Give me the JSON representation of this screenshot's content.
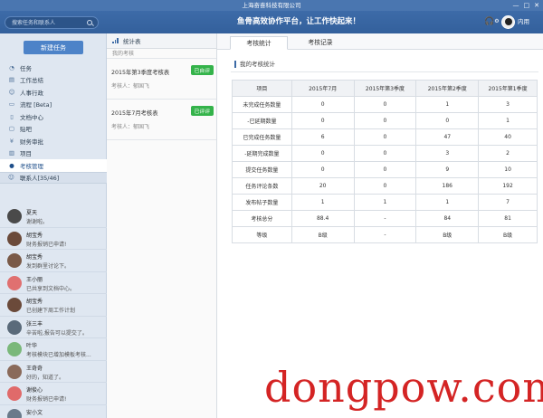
{
  "window": {
    "title": "上海奋奋科技有限公司",
    "controls": [
      "—",
      "□",
      "✕"
    ]
  },
  "header": {
    "search_placeholder": "搜索任务和联系人",
    "slogan": "鱼骨高效协作平台，让工作快起来！",
    "user_name": "内用"
  },
  "sidebar": {
    "new_task_label": "新建任务",
    "nav_items": [
      {
        "label": "任务",
        "icon": "task-icon",
        "glyph": "◔"
      },
      {
        "label": "工作总结",
        "icon": "summary-icon",
        "glyph": "▤"
      },
      {
        "label": "人事行政",
        "icon": "person-icon",
        "glyph": "☺"
      },
      {
        "label": "流程 [Beta]",
        "icon": "flow-icon",
        "glyph": "▭"
      },
      {
        "label": "文档中心",
        "icon": "document-icon",
        "glyph": "▯"
      },
      {
        "label": "贴吧",
        "icon": "forum-icon",
        "glyph": "▢"
      },
      {
        "label": "财务审批",
        "icon": "finance-icon",
        "glyph": "¥"
      },
      {
        "label": "项目",
        "icon": "project-icon",
        "glyph": "▥"
      },
      {
        "label": "考核管理",
        "icon": "assessment-icon",
        "glyph": "●",
        "active": true
      }
    ],
    "contacts_label": "联系人[35/46]",
    "contacts": [
      {
        "name": "夏天",
        "message": "谢谢啦。",
        "avatar_color": "#4a4a4a"
      },
      {
        "name": "胡宝秀",
        "message": "财务报销已申请!",
        "avatar_color": "#6b4a3a"
      },
      {
        "name": "胡宝秀",
        "message": "发到群里讨论下。",
        "avatar_color": "#7a5a48"
      },
      {
        "name": "王小丽",
        "message": "已共享到文档中心。",
        "avatar_color": "#e07070"
      },
      {
        "name": "胡宝秀",
        "message": "已创建下周工作计划",
        "avatar_color": "#6b4a3a"
      },
      {
        "name": "张三丰",
        "message": "辛苦啦,报告可以提交了。",
        "avatar_color": "#5a6a7a"
      },
      {
        "name": "叶华",
        "message": "考核模块已增加模板考核...",
        "avatar_color": "#7ab87a"
      },
      {
        "name": "王奇奇",
        "message": "好的，知道了。",
        "avatar_color": "#8a6a5a"
      },
      {
        "name": "谢俊心",
        "message": "财务报销已申请!",
        "avatar_color": "#e06a6a"
      },
      {
        "name": "安小文",
        "message": "",
        "avatar_color": "#6a7a8a"
      }
    ]
  },
  "middle": {
    "tab_label": "统计表",
    "subheader": "我的考核",
    "exams": [
      {
        "title": "2015年第3季度考核表",
        "meta": "考核人：郁国飞",
        "status": "已自评"
      },
      {
        "title": "2015年7月考核表",
        "meta": "考核人：郁国飞",
        "status": "已评评"
      }
    ]
  },
  "main": {
    "tabs": [
      "考核统计",
      "考核记录"
    ],
    "section_title": "我的考核统计",
    "table": {
      "headers": [
        "项目",
        "2015年7月",
        "2015年第3季度",
        "2015年第2季度",
        "2015年第1季度"
      ],
      "rows": [
        [
          "未完成任务数量",
          "0",
          "0",
          "1",
          "3"
        ],
        [
          "-已延期数量",
          "0",
          "0",
          "0",
          "1"
        ],
        [
          "已完成任务数量",
          "6",
          "0",
          "47",
          "40"
        ],
        [
          "-延期完成数量",
          "0",
          "0",
          "3",
          "2"
        ],
        [
          "提交任务数量",
          "0",
          "0",
          "9",
          "10"
        ],
        [
          "任务评论条数",
          "20",
          "0",
          "186",
          "192"
        ],
        [
          "发布帖子数量",
          "1",
          "1",
          "1",
          "7"
        ],
        [
          "考核总分",
          "88.4",
          "-",
          "84",
          "81"
        ],
        [
          "等级",
          "B级",
          "-",
          "B级",
          "B级"
        ]
      ]
    }
  },
  "watermark": "dongpow.com",
  "colors": {
    "brand": "#3d6ba8",
    "badge": "#34b34a",
    "watermark": "#d42424"
  }
}
